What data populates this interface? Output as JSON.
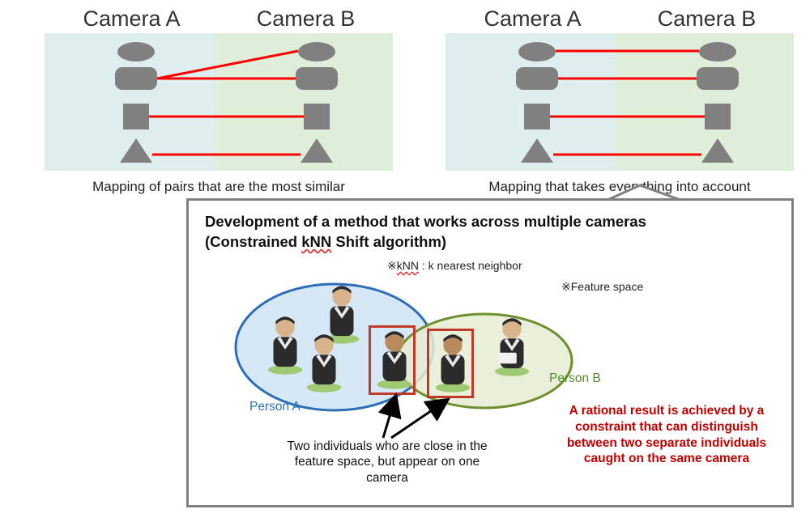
{
  "top": {
    "left": {
      "camA": "Camera A",
      "camB": "Camera B",
      "caption": "Mapping of pairs that are the most similar"
    },
    "right": {
      "camA": "Camera A",
      "camB": "Camera B",
      "caption": "Mapping that takes everything into account"
    }
  },
  "callout": {
    "title_l1": "Development of a method that works across multiple cameras",
    "title_l2_pre": "(Constrained ",
    "title_l2_wavy": "kNN",
    "title_l2_post": " Shift algorithm)",
    "knn_note_pre": "※",
    "knn_note_word": "kNN",
    "knn_note_post": " : k nearest neighbor",
    "fs_note": "※Feature space",
    "personA": "Person A",
    "personB": "Person B",
    "note_left": "Two individuals who are close in the feature space, but appear on one camera",
    "note_right": "A rational result is achieved by a constraint that can distinguish between two separate individuals caught on the same camera"
  }
}
